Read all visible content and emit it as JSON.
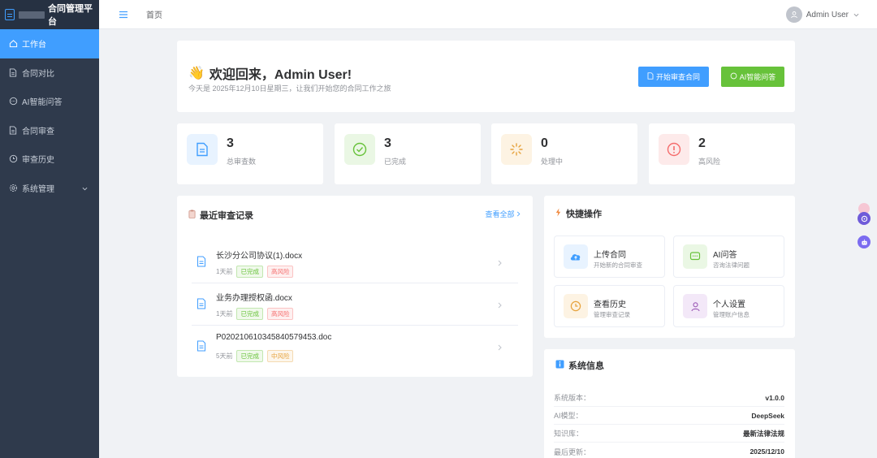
{
  "brand": {
    "title": "合同管理平台"
  },
  "sidebar": {
    "items": [
      {
        "label": "工作台",
        "icon": "home-icon",
        "active": true
      },
      {
        "label": "合同对比",
        "icon": "document-icon"
      },
      {
        "label": "AI智能问答",
        "icon": "chat-icon"
      },
      {
        "label": "合同审查",
        "icon": "document-icon"
      },
      {
        "label": "审查历史",
        "icon": "clock-icon"
      },
      {
        "label": "系统管理",
        "icon": "gear-icon",
        "expandable": true
      }
    ]
  },
  "topbar": {
    "breadcrumb": "首页",
    "user_name": "Admin User"
  },
  "welcome": {
    "emoji": "👋",
    "title": "欢迎回来，Admin User!",
    "subtitle": "今天是 2025年12月10日星期三，让我们开始您的合同工作之旅",
    "btn_review": "开始审查合同",
    "btn_ai": "AI智能问答"
  },
  "stats": [
    {
      "value": "3",
      "label": "总审查数",
      "icon": "document-icon",
      "color": "#409eff",
      "bg": "#e8f3ff"
    },
    {
      "value": "3",
      "label": "已完成",
      "icon": "check-circle-icon",
      "color": "#67c23a",
      "bg": "#eaf7e4"
    },
    {
      "value": "0",
      "label": "处理中",
      "icon": "loading-icon",
      "color": "#e6a23c",
      "bg": "#fdf3e3"
    },
    {
      "value": "2",
      "label": "高风险",
      "icon": "alert-circle-icon",
      "color": "#f56c6c",
      "bg": "#fdeaea"
    }
  ],
  "recent": {
    "title": "最近审查记录",
    "view_all": "查看全部",
    "records": [
      {
        "name": "长沙分公司协议(1).docx",
        "time": "1天前",
        "status": "已完成",
        "risk": "高风险",
        "risk_level": "high"
      },
      {
        "name": "业务办理授权函.docx",
        "time": "1天前",
        "status": "已完成",
        "risk": "高风险",
        "risk_level": "high"
      },
      {
        "name": "P020210610345840579453.doc",
        "time": "5天前",
        "status": "已完成",
        "risk": "中风险",
        "risk_level": "mid"
      }
    ]
  },
  "quick": {
    "title": "快捷操作",
    "actions": [
      {
        "title": "上传合同",
        "desc": "开始新的合同审查",
        "icon": "cloud-upload-icon",
        "color": "#409eff",
        "bg": "#e8f3ff"
      },
      {
        "title": "AI问答",
        "desc": "咨询法律问题",
        "icon": "chat-icon",
        "color": "#67c23a",
        "bg": "#eaf7e4"
      },
      {
        "title": "查看历史",
        "desc": "管理审查记录",
        "icon": "clock-icon",
        "color": "#e6a23c",
        "bg": "#fdf3e3"
      },
      {
        "title": "个人设置",
        "desc": "管理账户信息",
        "icon": "user-icon",
        "color": "#9b59b6",
        "bg": "#f3e8f8"
      }
    ]
  },
  "sysinfo": {
    "title": "系统信息",
    "rows": [
      {
        "key": "系统版本：",
        "value": "v1.0.0"
      },
      {
        "key": "AI模型：",
        "value": "DeepSeek"
      },
      {
        "key": "知识库：",
        "value": "最新法律法规"
      },
      {
        "key": "最后更新：",
        "value": "2025/12/10"
      }
    ]
  }
}
